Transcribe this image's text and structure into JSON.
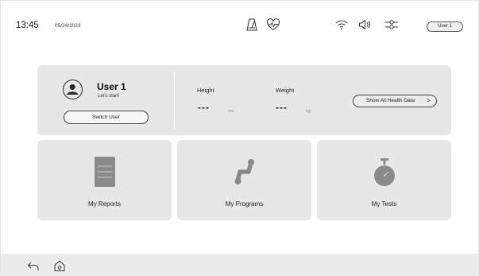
{
  "status_bar": {
    "time": "13:45",
    "date": "05/24/2023",
    "user_button": "User 1",
    "icons": [
      "metronome-icon",
      "heart-rate-icon",
      "wifi-icon",
      "volume-icon",
      "settings-sliders-icon"
    ]
  },
  "profile": {
    "name": "User 1",
    "subtitle": "Let's start!",
    "switch_label": "Switch User",
    "height": {
      "label": "Height",
      "value": "---",
      "unit": "cm"
    },
    "weight": {
      "label": "Weight",
      "value": "---",
      "unit": "kg"
    },
    "health_button": "Show All Health Data",
    "health_button_chevron": ">"
  },
  "tiles": [
    {
      "label": "My Reports",
      "icon": "report-document-icon"
    },
    {
      "label": "My Programs",
      "icon": "programs-path-icon"
    },
    {
      "label": "My Tests",
      "icon": "stopwatch-icon"
    }
  ],
  "bottom_nav": {
    "icons": [
      "back-arrow-icon",
      "home-icon"
    ]
  },
  "colors": {
    "card": "#e7e7e7",
    "icon_gray": "#8a8a8a",
    "bottom_bar": "#ececec"
  }
}
